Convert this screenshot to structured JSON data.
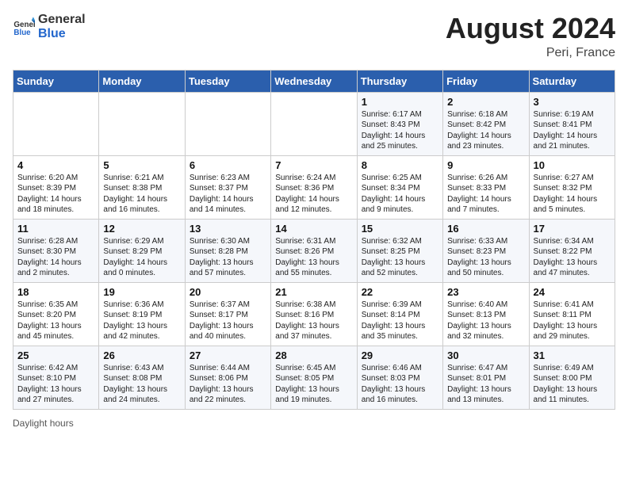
{
  "header": {
    "logo_line1": "General",
    "logo_line2": "Blue",
    "month_year": "August 2024",
    "location": "Peri, France"
  },
  "footer": {
    "daylight_label": "Daylight hours"
  },
  "days_of_week": [
    "Sunday",
    "Monday",
    "Tuesday",
    "Wednesday",
    "Thursday",
    "Friday",
    "Saturday"
  ],
  "weeks": [
    [
      {
        "day": "",
        "info": ""
      },
      {
        "day": "",
        "info": ""
      },
      {
        "day": "",
        "info": ""
      },
      {
        "day": "",
        "info": ""
      },
      {
        "day": "1",
        "info": "Sunrise: 6:17 AM\nSunset: 8:43 PM\nDaylight: 14 hours\nand 25 minutes."
      },
      {
        "day": "2",
        "info": "Sunrise: 6:18 AM\nSunset: 8:42 PM\nDaylight: 14 hours\nand 23 minutes."
      },
      {
        "day": "3",
        "info": "Sunrise: 6:19 AM\nSunset: 8:41 PM\nDaylight: 14 hours\nand 21 minutes."
      }
    ],
    [
      {
        "day": "4",
        "info": "Sunrise: 6:20 AM\nSunset: 8:39 PM\nDaylight: 14 hours\nand 18 minutes."
      },
      {
        "day": "5",
        "info": "Sunrise: 6:21 AM\nSunset: 8:38 PM\nDaylight: 14 hours\nand 16 minutes."
      },
      {
        "day": "6",
        "info": "Sunrise: 6:23 AM\nSunset: 8:37 PM\nDaylight: 14 hours\nand 14 minutes."
      },
      {
        "day": "7",
        "info": "Sunrise: 6:24 AM\nSunset: 8:36 PM\nDaylight: 14 hours\nand 12 minutes."
      },
      {
        "day": "8",
        "info": "Sunrise: 6:25 AM\nSunset: 8:34 PM\nDaylight: 14 hours\nand 9 minutes."
      },
      {
        "day": "9",
        "info": "Sunrise: 6:26 AM\nSunset: 8:33 PM\nDaylight: 14 hours\nand 7 minutes."
      },
      {
        "day": "10",
        "info": "Sunrise: 6:27 AM\nSunset: 8:32 PM\nDaylight: 14 hours\nand 5 minutes."
      }
    ],
    [
      {
        "day": "11",
        "info": "Sunrise: 6:28 AM\nSunset: 8:30 PM\nDaylight: 14 hours\nand 2 minutes."
      },
      {
        "day": "12",
        "info": "Sunrise: 6:29 AM\nSunset: 8:29 PM\nDaylight: 14 hours\nand 0 minutes."
      },
      {
        "day": "13",
        "info": "Sunrise: 6:30 AM\nSunset: 8:28 PM\nDaylight: 13 hours\nand 57 minutes."
      },
      {
        "day": "14",
        "info": "Sunrise: 6:31 AM\nSunset: 8:26 PM\nDaylight: 13 hours\nand 55 minutes."
      },
      {
        "day": "15",
        "info": "Sunrise: 6:32 AM\nSunset: 8:25 PM\nDaylight: 13 hours\nand 52 minutes."
      },
      {
        "day": "16",
        "info": "Sunrise: 6:33 AM\nSunset: 8:23 PM\nDaylight: 13 hours\nand 50 minutes."
      },
      {
        "day": "17",
        "info": "Sunrise: 6:34 AM\nSunset: 8:22 PM\nDaylight: 13 hours\nand 47 minutes."
      }
    ],
    [
      {
        "day": "18",
        "info": "Sunrise: 6:35 AM\nSunset: 8:20 PM\nDaylight: 13 hours\nand 45 minutes."
      },
      {
        "day": "19",
        "info": "Sunrise: 6:36 AM\nSunset: 8:19 PM\nDaylight: 13 hours\nand 42 minutes."
      },
      {
        "day": "20",
        "info": "Sunrise: 6:37 AM\nSunset: 8:17 PM\nDaylight: 13 hours\nand 40 minutes."
      },
      {
        "day": "21",
        "info": "Sunrise: 6:38 AM\nSunset: 8:16 PM\nDaylight: 13 hours\nand 37 minutes."
      },
      {
        "day": "22",
        "info": "Sunrise: 6:39 AM\nSunset: 8:14 PM\nDaylight: 13 hours\nand 35 minutes."
      },
      {
        "day": "23",
        "info": "Sunrise: 6:40 AM\nSunset: 8:13 PM\nDaylight: 13 hours\nand 32 minutes."
      },
      {
        "day": "24",
        "info": "Sunrise: 6:41 AM\nSunset: 8:11 PM\nDaylight: 13 hours\nand 29 minutes."
      }
    ],
    [
      {
        "day": "25",
        "info": "Sunrise: 6:42 AM\nSunset: 8:10 PM\nDaylight: 13 hours\nand 27 minutes."
      },
      {
        "day": "26",
        "info": "Sunrise: 6:43 AM\nSunset: 8:08 PM\nDaylight: 13 hours\nand 24 minutes."
      },
      {
        "day": "27",
        "info": "Sunrise: 6:44 AM\nSunset: 8:06 PM\nDaylight: 13 hours\nand 22 minutes."
      },
      {
        "day": "28",
        "info": "Sunrise: 6:45 AM\nSunset: 8:05 PM\nDaylight: 13 hours\nand 19 minutes."
      },
      {
        "day": "29",
        "info": "Sunrise: 6:46 AM\nSunset: 8:03 PM\nDaylight: 13 hours\nand 16 minutes."
      },
      {
        "day": "30",
        "info": "Sunrise: 6:47 AM\nSunset: 8:01 PM\nDaylight: 13 hours\nand 13 minutes."
      },
      {
        "day": "31",
        "info": "Sunrise: 6:49 AM\nSunset: 8:00 PM\nDaylight: 13 hours\nand 11 minutes."
      }
    ]
  ]
}
